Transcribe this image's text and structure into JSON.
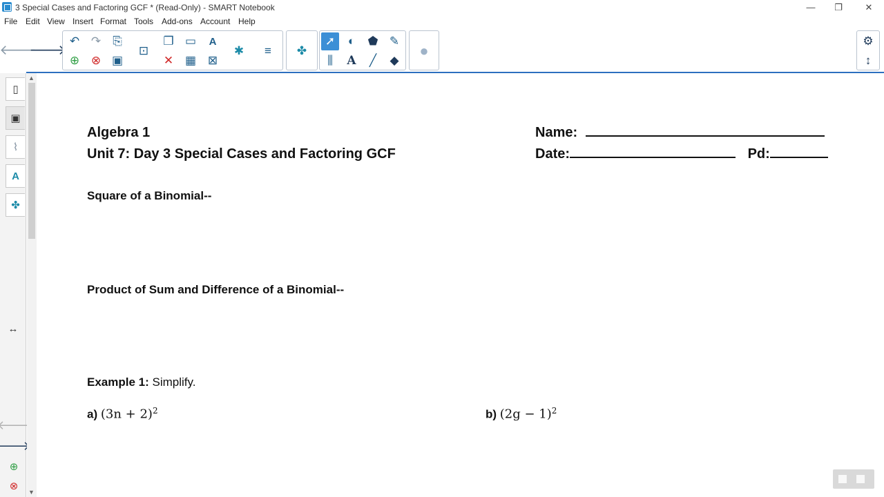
{
  "window": {
    "title": "3 Special Cases and Factoring GCF * (Read-Only) - SMART Notebook"
  },
  "menu": [
    "File",
    "Edit",
    "View",
    "Insert",
    "Format",
    "Tools",
    "Add-ons",
    "Account",
    "Help"
  ],
  "toolbar": {
    "buttons": [
      "back-icon",
      "forward-icon",
      "undo-icon",
      "redo-icon",
      "paste-icon",
      "new-page-icon",
      "delete-page-icon",
      "save-icon",
      "screen-shade-icon",
      "fullscreen-icon",
      "text-icon",
      "delete-icon",
      "table-icon",
      "clear-icon",
      "addon-icon",
      "align-icon",
      "puzzle-icon",
      "select-icon",
      "shapes-icon",
      "fill-icon",
      "pen-icon",
      "measure-icon",
      "text-tool-icon",
      "line-icon",
      "eraser-icon",
      "document-camera-icon",
      "settings-icon",
      "toolbar-move-icon"
    ]
  },
  "sidebar": {
    "tabs": [
      "page-sorter-icon",
      "gallery-icon",
      "attachments-icon",
      "properties-icon",
      "addons-icon"
    ],
    "expand_icon": "resize-horizontal-icon"
  },
  "document": {
    "course": "Algebra 1",
    "unit": "Unit 7: Day 3 Special Cases and Factoring GCF",
    "name_label": "Name:",
    "date_label": "Date:",
    "period_label": "Pd:",
    "section1": "Square of a Binomial--",
    "section2": "Product of Sum and Difference of a Binomial--",
    "example_label": "Example 1:",
    "example_text": "Simplify.",
    "part_a_label": "a)",
    "part_a_expr": "(3n + 2)",
    "part_a_exp": "2",
    "part_b_label": "b)",
    "part_b_expr": "(2g − 1)",
    "part_b_exp": "2"
  }
}
